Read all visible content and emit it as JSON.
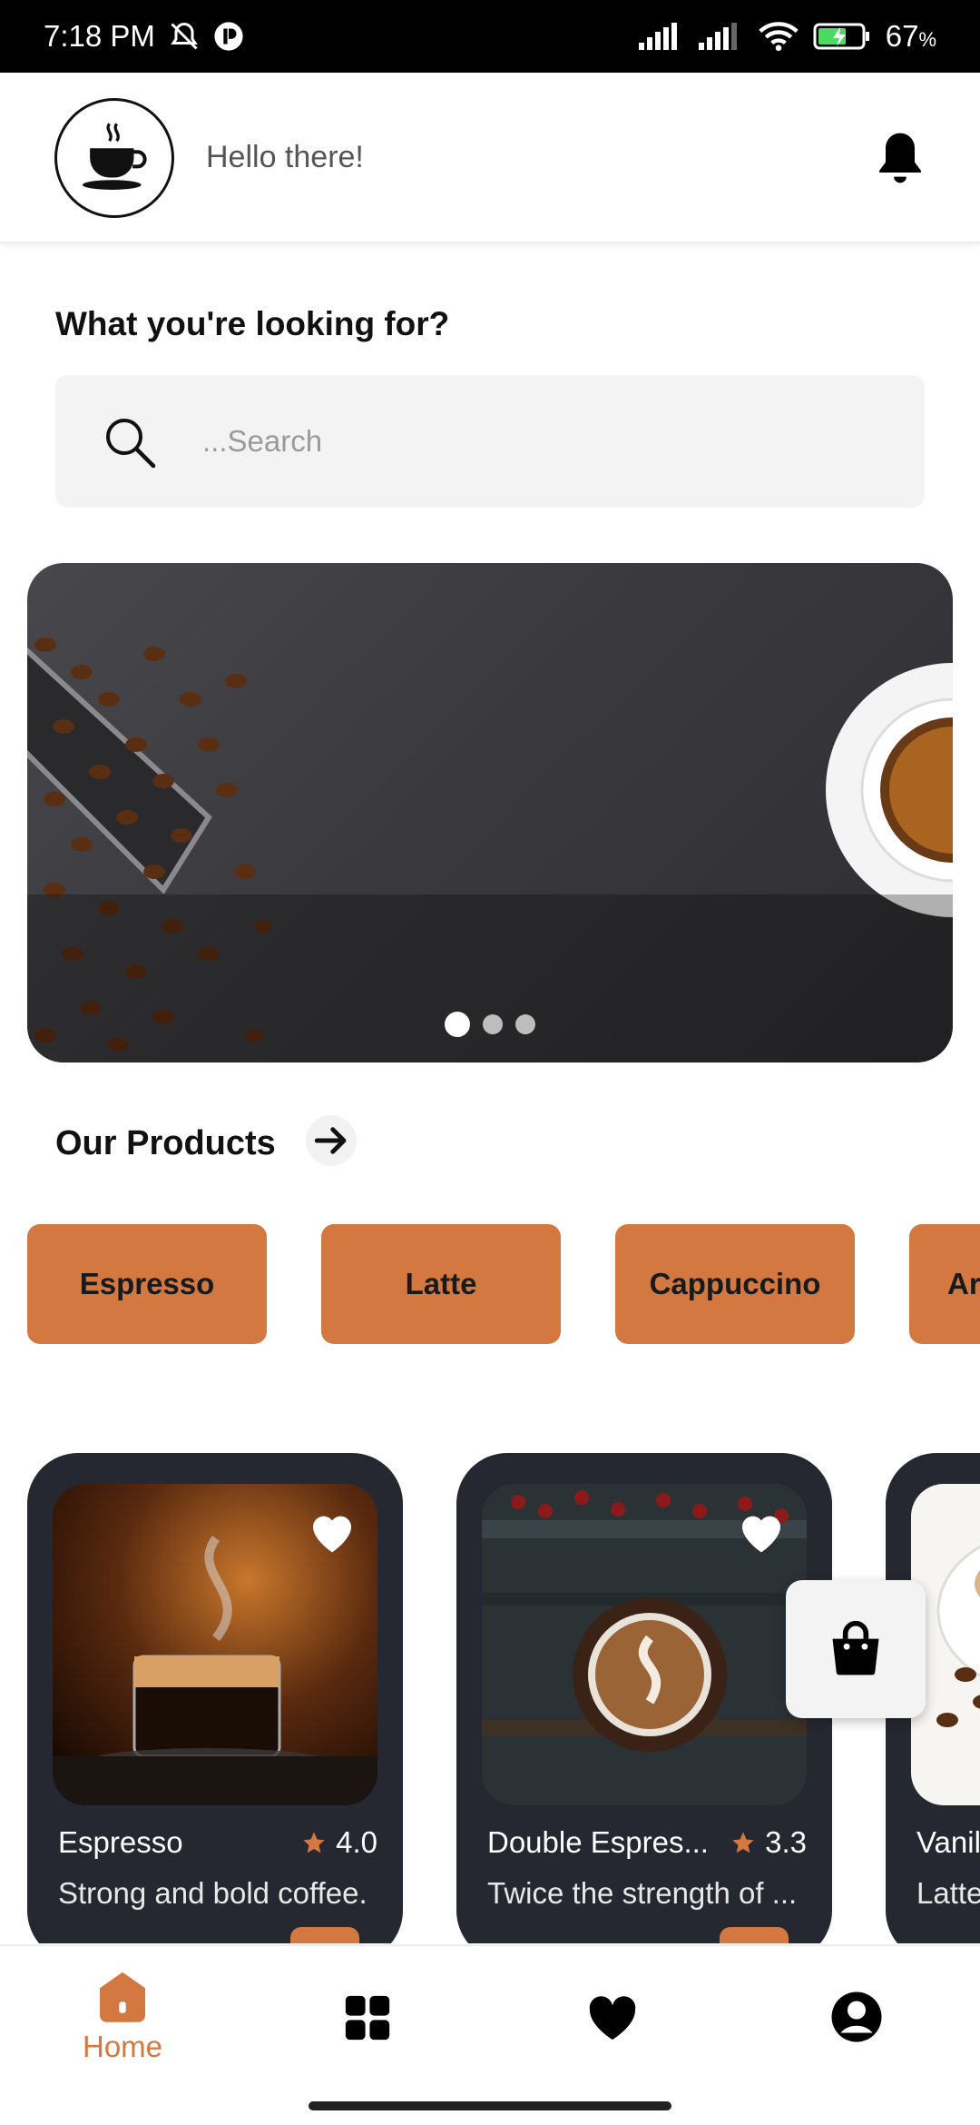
{
  "status_bar": {
    "time": "7:18 PM",
    "battery": "67",
    "battery_unit": "%"
  },
  "header": {
    "greeting": "Hello there!"
  },
  "search": {
    "heading": "What you're looking for?",
    "placeholder": "...Search"
  },
  "banner": {
    "slide_count": 3,
    "active_slide": 1
  },
  "products": {
    "title": "Our Products",
    "categories": [
      "Espresso",
      "Latte",
      "Cappuccino",
      "Ar"
    ]
  },
  "cards": [
    {
      "name": "Espresso",
      "rating": "4.0",
      "description": "Strong and bold coffee."
    },
    {
      "name": "Double Espres...",
      "rating": "3.3",
      "description": "Twice the strength of ..."
    },
    {
      "name": "Vanil",
      "rating": "",
      "description": "Latte"
    }
  ],
  "bottom_nav": {
    "home_label": "Home"
  },
  "colors": {
    "accent": "#d37841",
    "card_bg": "#252830"
  }
}
